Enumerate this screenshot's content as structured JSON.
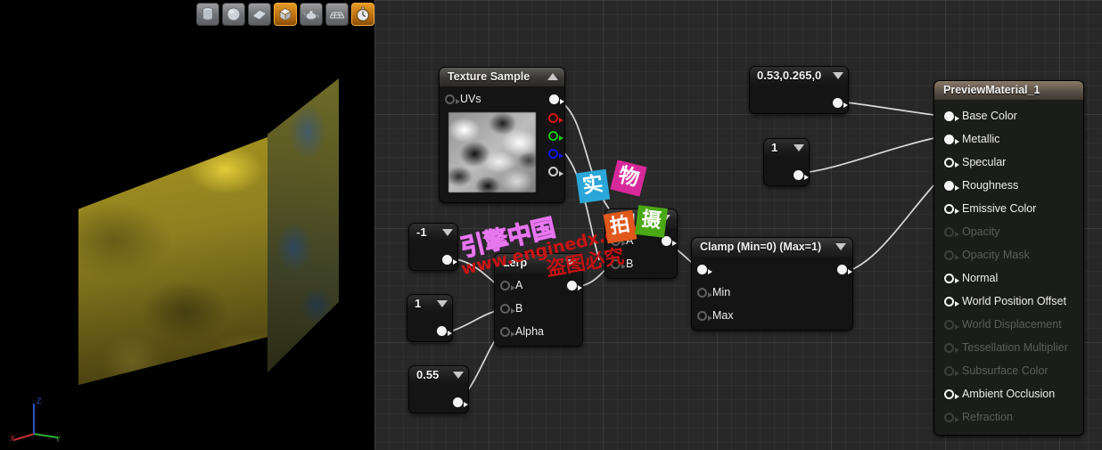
{
  "viewport": {
    "name": "material-preview-viewport",
    "toolbar": {
      "buttons": [
        {
          "name": "cylinder-mesh-button",
          "icon": "cylinder-icon",
          "tooltip": "Cylinder",
          "active": false
        },
        {
          "name": "sphere-mesh-button",
          "icon": "sphere-icon",
          "tooltip": "Sphere",
          "active": false
        },
        {
          "name": "plane-mesh-button",
          "icon": "plane-icon",
          "tooltip": "Plane",
          "active": false
        },
        {
          "name": "cube-mesh-button",
          "icon": "cube-icon",
          "tooltip": "Cube",
          "active": true
        },
        {
          "name": "teapot-mesh-button",
          "icon": "teapot-icon",
          "tooltip": "Teapot",
          "active": false
        },
        {
          "name": "grid-toggle-button",
          "icon": "grid-icon",
          "tooltip": "Grid",
          "active": false
        },
        {
          "name": "realtime-toggle-button",
          "icon": "stopwatch-icon",
          "tooltip": "Realtime",
          "active": true
        }
      ]
    },
    "axis_gizmo": {
      "x": "X",
      "y": "Y",
      "z": "Z",
      "x_color": "#c03030",
      "y_color": "#2fb02f",
      "z_color": "#3050c0"
    }
  },
  "graph": {
    "background_color": "#282828",
    "nodes": {
      "texture_sample": {
        "title": "Texture Sample",
        "collapse_icon": "chevron-up-icon",
        "inputs": [
          {
            "label": "UVs",
            "pin": "hollow-grey"
          }
        ],
        "outputs": [
          {
            "label": "",
            "pin": "white-solid"
          },
          {
            "label": "",
            "pin": "red-hollow"
          },
          {
            "label": "",
            "pin": "green-hollow"
          },
          {
            "label": "",
            "pin": "blue-hollow"
          },
          {
            "label": "",
            "pin": "alpha-hollow"
          }
        ]
      },
      "const_neg1": {
        "title": "-1",
        "collapse_icon": "chevron-down-icon"
      },
      "const_1a": {
        "title": "1",
        "collapse_icon": "chevron-down-icon"
      },
      "const_055": {
        "title": "0.55",
        "collapse_icon": "chevron-down-icon"
      },
      "const_vector": {
        "title": "0.53,0.265,0",
        "collapse_icon": "chevron-down-icon"
      },
      "const_1b": {
        "title": "1",
        "collapse_icon": "chevron-down-icon"
      },
      "lerp": {
        "title": "Lerp",
        "collapse_icon": "chevron-down-icon",
        "inputs": [
          {
            "label": "A",
            "pin": "hollow-grey"
          },
          {
            "label": "B",
            "pin": "hollow-grey"
          },
          {
            "label": "Alpha",
            "pin": "hollow-grey"
          }
        ]
      },
      "add": {
        "title": "Add",
        "collapse_icon": "chevron-down-icon",
        "inputs": [
          {
            "label": "A",
            "pin": "hollow-grey"
          },
          {
            "label": "B",
            "pin": "hollow-grey"
          }
        ]
      },
      "clamp": {
        "title": "Clamp (Min=0) (Max=1)",
        "collapse_icon": "chevron-down-icon",
        "inputs": [
          {
            "label": "",
            "pin": "white-solid"
          },
          {
            "label": "Min",
            "pin": "hollow-grey"
          },
          {
            "label": "Max",
            "pin": "hollow-grey"
          }
        ]
      },
      "result": {
        "title": "PreviewMaterial_1",
        "inputs": [
          {
            "label": "Base Color",
            "pin": "white-solid",
            "enabled": true
          },
          {
            "label": "Metallic",
            "pin": "white-solid",
            "enabled": true
          },
          {
            "label": "Specular",
            "pin": "white-hollow",
            "enabled": true
          },
          {
            "label": "Roughness",
            "pin": "white-solid",
            "enabled": true
          },
          {
            "label": "Emissive Color",
            "pin": "white-hollow",
            "enabled": true
          },
          {
            "label": "Opacity",
            "pin": "dim-hollow",
            "enabled": false
          },
          {
            "label": "Opacity Mask",
            "pin": "dim-hollow",
            "enabled": false
          },
          {
            "label": "Normal",
            "pin": "white-hollow",
            "enabled": true
          },
          {
            "label": "World Position Offset",
            "pin": "white-hollow",
            "enabled": true
          },
          {
            "label": "World Displacement",
            "pin": "dim-hollow",
            "enabled": false
          },
          {
            "label": "Tessellation Multiplier",
            "pin": "dim-hollow",
            "enabled": false
          },
          {
            "label": "Subsurface Color",
            "pin": "dim-hollow",
            "enabled": false
          },
          {
            "label": "Ambient Occlusion",
            "pin": "white-hollow",
            "enabled": true
          },
          {
            "label": "Refraction",
            "pin": "dim-hollow",
            "enabled": false
          }
        ]
      }
    }
  },
  "watermarks": {
    "site_cn": "引擎中国",
    "url": "www.enginedx.com",
    "notice": "盗图必究",
    "stickers": [
      {
        "text": "实",
        "color": "#2aa7d8"
      },
      {
        "text": "物",
        "color": "#d8299b"
      },
      {
        "text": "拍",
        "color": "#e0581c"
      },
      {
        "text": "摄",
        "color": "#49a814"
      }
    ]
  }
}
